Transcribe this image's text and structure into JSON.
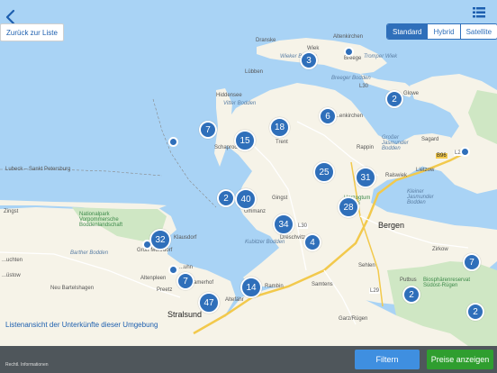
{
  "nav": {
    "back_label": "Zurück zur Liste",
    "map_types": [
      "Standard",
      "Hybrid",
      "Satellite"
    ],
    "active_map_type": "Standard"
  },
  "footer": {
    "list_view_text": "Listenansicht der Unterkünfte dieser Umgebung",
    "legal_text": "Rechtl. Informationen",
    "filter_label": "Filtern",
    "prices_label": "Preise anzeigen"
  },
  "clusters": [
    "3",
    "2",
    "7",
    "18",
    "6",
    "15",
    "25",
    "31",
    "2",
    "40",
    "28",
    "34",
    "4",
    "32",
    "7",
    "14",
    "47",
    "2",
    "2",
    "7"
  ],
  "map_labels": {
    "dranske": "Dranske",
    "wiek": "Wiek",
    "altenkirchen": "Altenkirchen",
    "wieker_bodden": "Wieker Bodden",
    "breege": "Breege",
    "tromper_wiek": "Tromper Wiek",
    "lubben": "Lübben",
    "breeger_bodden": "Breeger Bodden",
    "hiddensee": "Hiddensee",
    "vitter_bodden": "Vitter Bodden",
    "l30a": "L30",
    "glowe": "Glowe",
    "ganzkirchen": "...enkirchen",
    "trent": "Trent",
    "schaprode": "Schaprode",
    "rappin": "Rappin",
    "grosser_jasmunder": "Großer Jasmunder Bodden",
    "sagard": "Sagard",
    "lietzow": "Lietzow",
    "b96": "B96",
    "l29": "L29",
    "ralswiek": "Ralswiek",
    "kleiner_jasmunder": "Kleiner Jasmunder Bodden",
    "gingst": "Gingst",
    "ummanz": "Ummanz",
    "l30b": "L30",
    "herzogtum_rugen": "Herzogtum Rügen",
    "bergen": "Bergen",
    "zingst": "Zingst",
    "nationalpark": "Nationalpark Vorpommersche Boddenlandschaft",
    "barther_bodden": "Barther Bodden",
    "kubitzer_bodden": "Kubitzer Bodden",
    "dreschvitz": "Dreschvitz",
    "zirkow": "Zirkow",
    "kl_mohrdorf": "Groß Mohrdorf",
    "klausdorf": "Klausdorf",
    "huchten": "...uchten",
    "lustow": "...üstow",
    "neu_bartelshagen": "Neu Bartelshagen",
    "altenpleen": "Altenpleen",
    "preetz": "Preetz",
    "rambin": "Rambin",
    "samtens": "Samtens",
    "sehlen": "Sehlen",
    "putbus": "Putbus",
    "biosphere": "Biosphärenreservat Südost-Rügen",
    "l29b": "L29",
    "altefahr": "Altefähr",
    "stralsund": "Stralsund",
    "garz": "Garz/Rügen",
    "lubeck_petersburg": "Lubeck – Sankt Petersburg",
    "kamerhof": "...amerhof",
    "muhn": "...uhn"
  }
}
